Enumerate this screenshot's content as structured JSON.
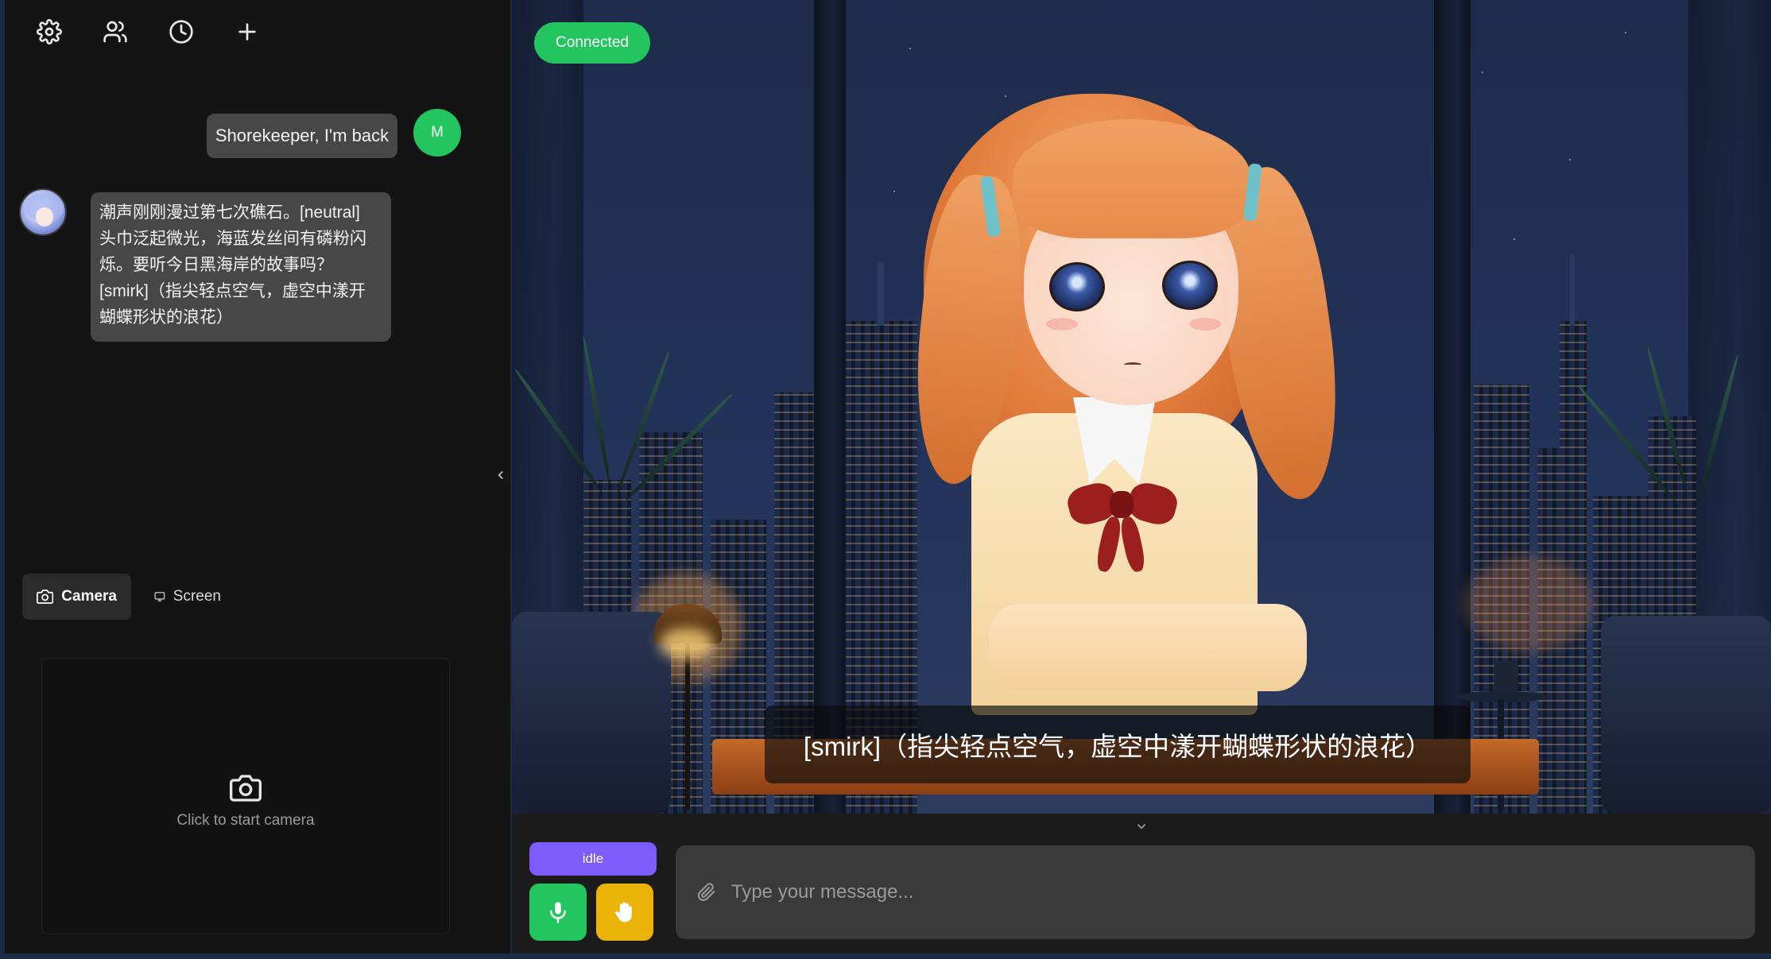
{
  "sidebar": {
    "toolbar": {
      "settings_icon": "gear-icon",
      "characters_icon": "users-icon",
      "history_icon": "clock-icon",
      "new_chat_icon": "plus-icon"
    },
    "messages": [
      {
        "role": "user",
        "avatar_initial": "M",
        "text": "Shorekeeper, I'm back"
      },
      {
        "role": "ai",
        "lines": [
          "潮声刚刚漫过第七次礁石。[neutral]",
          "头巾泛起微光，海蓝发丝间有磷粉闪",
          "烁。要听今日黑海岸的故事吗？",
          "[smirk]（指尖轻点空气，虚空中漾开",
          "蝴蝶形状的浪花）"
        ]
      }
    ],
    "tabs": [
      {
        "label": "Camera",
        "icon": "camera-icon",
        "active": true
      },
      {
        "label": "Screen",
        "icon": "monitor-icon",
        "active": false
      }
    ],
    "camera_panel": {
      "hint": "Click to start camera",
      "icon": "camera-icon"
    }
  },
  "stage": {
    "connection_status": "Connected",
    "subtitle": "[smirk]（指尖轻点空气，虚空中漾开蝴蝶形状的浪花）"
  },
  "controls": {
    "state_label": "idle",
    "mic_icon": "mic-icon",
    "interrupt_icon": "hand-icon",
    "attach_icon": "paperclip-icon",
    "input_placeholder": "Type your message...",
    "input_value": ""
  },
  "colors": {
    "connected": "#22c55e",
    "idle_state": "#7c5cfa",
    "mic_button": "#22c55e",
    "interrupt_button": "#eab308",
    "user_avatar": "#22c55e",
    "sidebar_bg": "#141414",
    "bubble_bg": "#474747"
  }
}
